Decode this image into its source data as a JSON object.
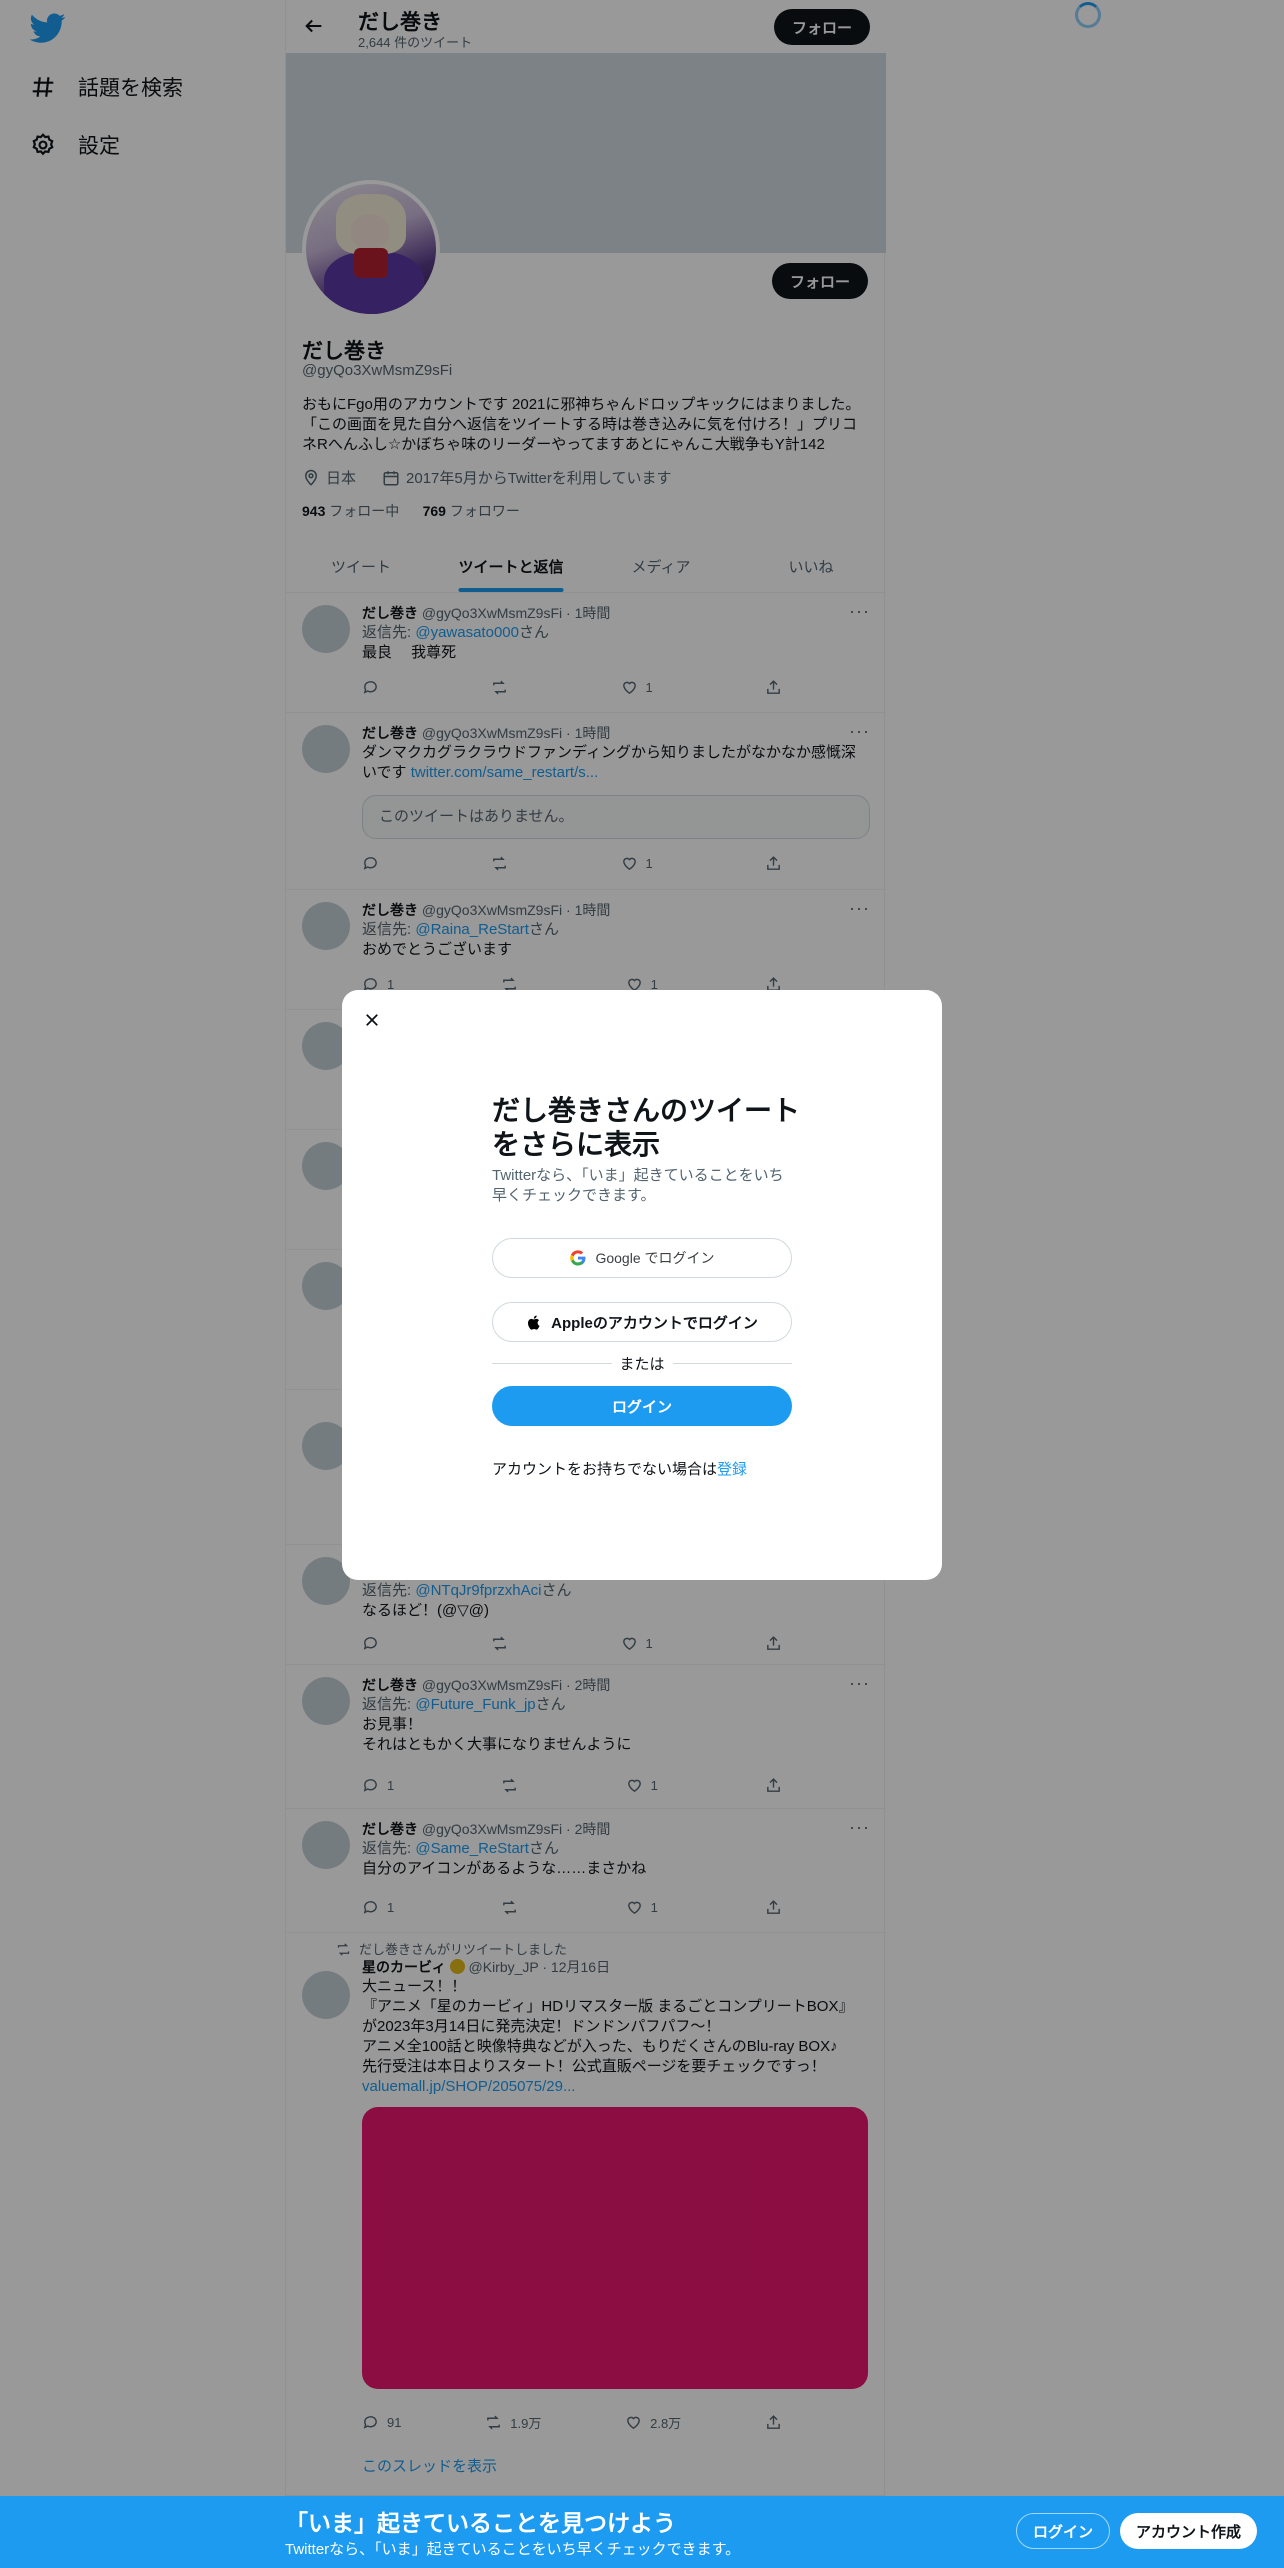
{
  "nav": {
    "explore_label": "話題を検索",
    "settings_label": "設定"
  },
  "header": {
    "name": "だし巻き",
    "tweet_count": "2,644 件のツイート",
    "follow_label": "フォロー"
  },
  "profile": {
    "name": "だし巻き",
    "handle": "@gyQo3XwMsmZ9sFi",
    "bio_line1": "おもにFgo用のアカウントです 2021に邪神ちゃんドロップキックにはまりました。",
    "bio_line2": "「この画面を見た自分へ返信をツイートする時は巻き込みに気を付けろ！」プリコ",
    "bio_line3": "ネRへんふし☆かぼちゃ味のリーダーやってますあとにゃんこ大戦争もY計142",
    "location": "日本",
    "joined": "2017年5月からTwitterを利用しています",
    "following_count": "943",
    "following_label": "フォロー中",
    "followers_count": "769",
    "followers_label": "フォロワー",
    "follow_label": "フォロー"
  },
  "tabs": [
    {
      "label": "ツイート"
    },
    {
      "label": "ツイートと返信"
    },
    {
      "label": "メディア"
    },
    {
      "label": "いいね"
    }
  ],
  "tweets": [
    {
      "name": "だし巻き",
      "meta": "@gyQo3XwMsmZ9sFi · 1時間",
      "reply_prefix": "返信先: ",
      "reply_to": "@yawasato000",
      "reply_suffix": "さん",
      "text": "最良　 我尊死",
      "likes": "1"
    },
    {
      "name": "だし巻き",
      "meta": "@gyQo3XwMsmZ9sFi · 1時間",
      "text1": "ダンマクカグラクラウドファンディングから知りましたがなかなか感慨深",
      "text2_prefix": "いです ",
      "text2_link": "twitter.com/same_restart/s...",
      "quote": "このツイートはありません。",
      "likes": "1"
    },
    {
      "name": "だし巻き",
      "meta": "@gyQo3XwMsmZ9sFi · 1時間",
      "reply_prefix": "返信先: ",
      "reply_to": "@Raina_ReStart",
      "reply_suffix": "さん",
      "text": "おめでとうございます",
      "replies": "1",
      "likes": "1"
    },
    {
      "reply_prefix": "返信先: ",
      "reply_to": "@NTqJr9fprzxhAci",
      "reply_suffix": "さん",
      "text": "なるほど！(@▽@)",
      "likes": "1"
    },
    {
      "name": "だし巻き",
      "meta": "@gyQo3XwMsmZ9sFi · 2時間",
      "reply_prefix": "返信先: ",
      "reply_to": "@Future_Funk_jp",
      "reply_suffix": "さん",
      "text1": "お見事！",
      "text2": "それはともかく大事になりませんように",
      "replies": "1",
      "likes": "1"
    },
    {
      "name": "だし巻き",
      "meta": "@gyQo3XwMsmZ9sFi · 2時間",
      "reply_prefix": "返信先: ",
      "reply_to": "@Same_ReStart",
      "reply_suffix": "さん",
      "text": "自分のアイコンがあるような……まさかね",
      "replies": "1",
      "likes": "1"
    },
    {
      "retweet_label": "だし巻きさんがリツイートしました",
      "name": "星のカービィ",
      "meta": "@Kirby_JP · 12月16日",
      "line1": "大ニュース！！",
      "line2": "『アニメ「星のカービィ」HDリマスター版 まるごとコンプリートBOX』",
      "line3": "が2023年3月14日に発売決定！ドンドンパフパフ～！",
      "line4": "アニメ全100話と映像特典などが入った、もりだくさんのBlu-ray BOX♪",
      "line5": "先行受注は本日よりスタート！公式直販ページを要チェックですっ！",
      "link": "valuemall.jp/SHOP/205075/29...",
      "replies": "91",
      "retweets": "1.9万",
      "likes": "2.8万",
      "thread_label": "このスレッドを表示"
    }
  ],
  "modal": {
    "title": "だし巻きさんのツイートをさらに表示",
    "subtitle": "Twitterなら、「いま」起きていることをいち早くチェックできます。",
    "google_label": "Google でログイン",
    "apple_label": "Appleのアカウントでログイン",
    "or_label": "または",
    "login_label": "ログイン",
    "signup_prefix": "アカウントをお持ちでない場合は",
    "signup_link": "登録"
  },
  "bottom_bar": {
    "title": "「いま」起きていることを見つけよう",
    "subtitle": "Twitterなら、「いま」起きていることをいち早くチェックできます。",
    "login_label": "ログイン",
    "signup_label": "アカウント作成"
  },
  "colors": {
    "accent": "#1d9bf0",
    "media_fill": "#e8176e"
  }
}
